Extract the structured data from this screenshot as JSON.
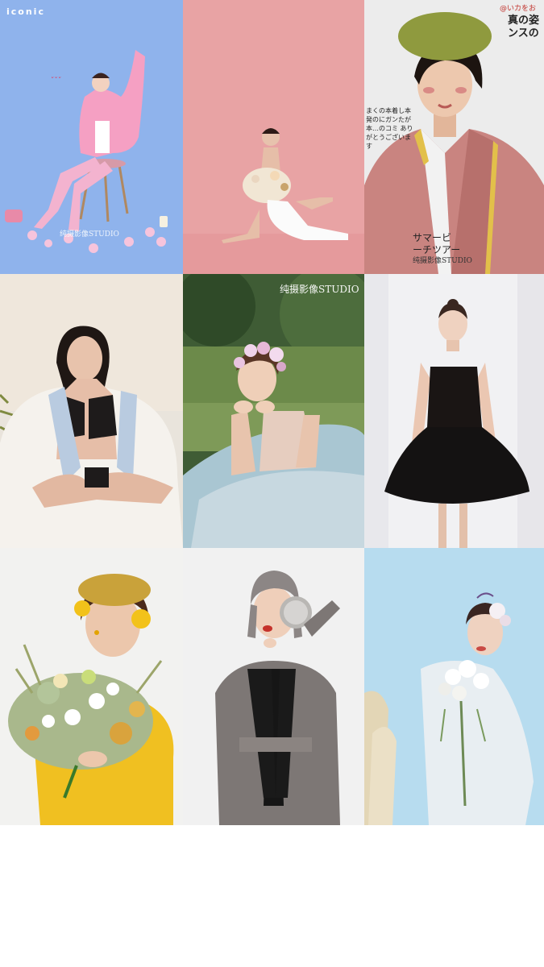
{
  "tile1": {
    "logo": "iconic",
    "watermark": "纯摄影像STUDIO"
  },
  "tile3": {
    "jp_top_line1": "@いカをお",
    "jp_top_line2": "真の姿",
    "jp_top_line3": "ンスの",
    "jp_side": "まくの本着し本発のにガンたが本…のコミ ありがとうございます",
    "jp_bottom_line1": "サマービ",
    "jp_bottom_line2": "ーチツアー",
    "watermark": "纯摄影像STUDIO"
  },
  "tile5": {
    "watermark": "纯摄影像STUDIO"
  },
  "colors": {
    "tile1_bg": "#8fb3ec",
    "tile2_bg": "#e8a3a4",
    "tile3_bg": "#ececec",
    "tile9_bg": "#b7dcef"
  }
}
